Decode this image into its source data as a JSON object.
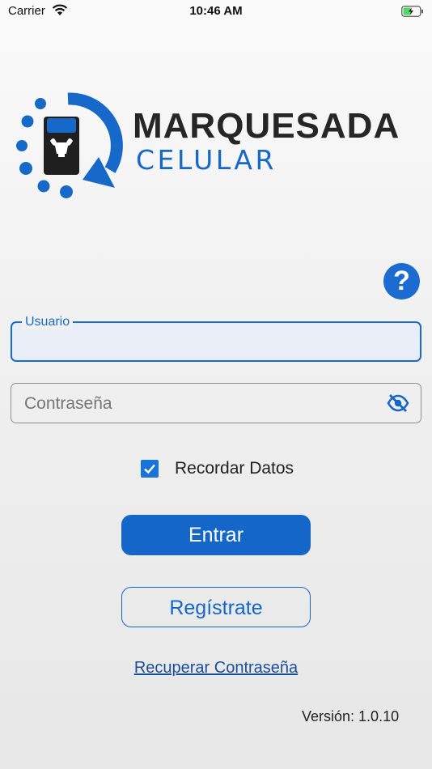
{
  "status_bar": {
    "carrier": "Carrier",
    "time": "10:46 AM"
  },
  "brand": {
    "title": "MARQUESADA",
    "subtitle": "CELULAR"
  },
  "help": {
    "label": "?"
  },
  "login_form": {
    "username_label": "Usuario",
    "username_value": "",
    "password_placeholder": "Contraseña",
    "remember_label": "Recordar Datos",
    "remember_checked": true
  },
  "actions": {
    "login_label": "Entrar",
    "register_label": "Regístrate",
    "recover_label": "Recuperar Contraseña"
  },
  "footer": {
    "version": "Versión: 1.0.10"
  },
  "colors": {
    "primary": "#1566c9",
    "text": "#222222",
    "brand_dark": "#262626"
  },
  "icons": [
    "wifi-icon",
    "battery-icon",
    "logo-icon",
    "help-icon",
    "eye-off-icon",
    "check-icon"
  ]
}
